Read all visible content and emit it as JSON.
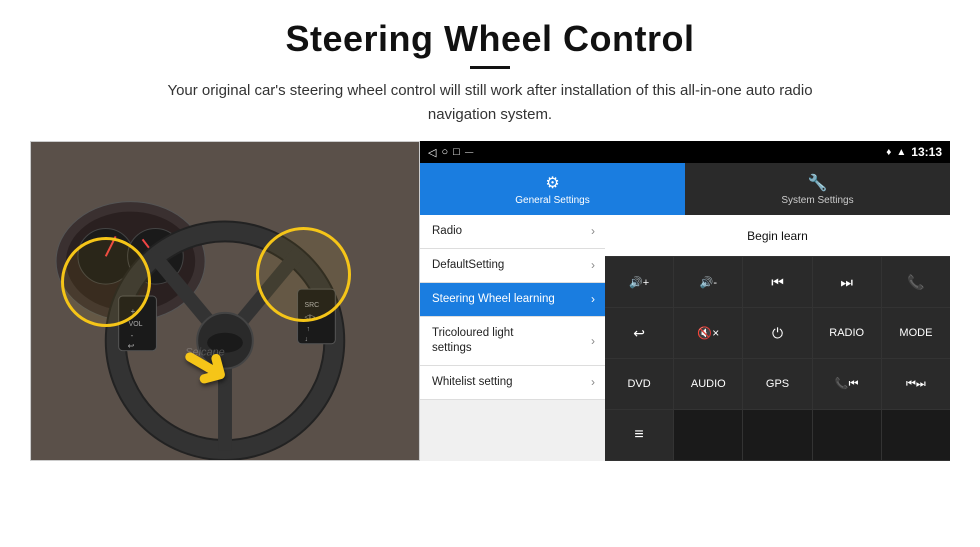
{
  "page": {
    "title": "Steering Wheel Control",
    "divider": true,
    "subtitle": "Your original car's steering wheel control will still work after installation of this all-in-one auto radio navigation system."
  },
  "status_bar": {
    "icons": [
      "◁",
      "○",
      "□",
      "⏤"
    ],
    "right_icons": [
      "location",
      "wifi"
    ],
    "time": "13:13"
  },
  "tabs": {
    "general": {
      "label": "General Settings",
      "icon": "⚙",
      "active": true
    },
    "system": {
      "label": "System Settings",
      "icon": "🔧",
      "active": false
    }
  },
  "menu_items": [
    {
      "label": "Radio",
      "active": false
    },
    {
      "label": "DefaultSetting",
      "active": false
    },
    {
      "label": "Steering Wheel learning",
      "active": true
    },
    {
      "label": "Tricoloured light settings",
      "active": false
    },
    {
      "label": "Whitelist setting",
      "active": false
    }
  ],
  "control": {
    "begin_learn": "Begin learn",
    "rows": [
      [
        {
          "label": "🔇+",
          "type": "icon"
        },
        {
          "label": "🔇-",
          "type": "icon"
        },
        {
          "label": "⏮",
          "type": "icon"
        },
        {
          "label": "⏭",
          "type": "icon"
        },
        {
          "label": "📞",
          "type": "icon"
        }
      ],
      [
        {
          "label": "↩",
          "type": "icon"
        },
        {
          "label": "🔇×",
          "type": "icon"
        },
        {
          "label": "⏻",
          "type": "icon"
        },
        {
          "label": "RADIO",
          "type": "text"
        },
        {
          "label": "MODE",
          "type": "text"
        }
      ],
      [
        {
          "label": "DVD",
          "type": "text"
        },
        {
          "label": "AUDIO",
          "type": "text"
        },
        {
          "label": "GPS",
          "type": "text"
        },
        {
          "label": "📞⏮",
          "type": "icon"
        },
        {
          "label": "⏮⏭",
          "type": "icon"
        }
      ],
      [
        {
          "label": "📋",
          "type": "icon"
        }
      ]
    ]
  }
}
